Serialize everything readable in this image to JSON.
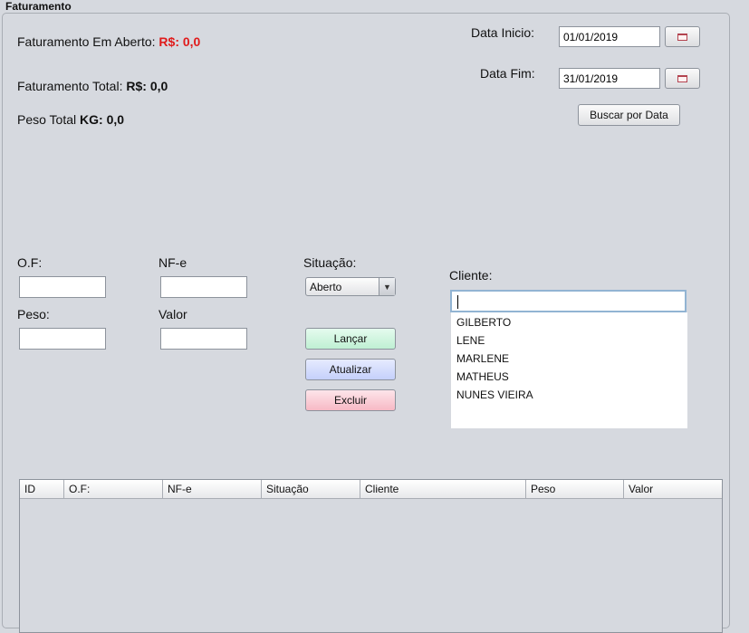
{
  "panel": {
    "title": "Faturamento"
  },
  "summary": {
    "aberto_label": "Faturamento Em Aberto:",
    "aberto_currency": "R$:",
    "aberto_value": "0,0",
    "total_label": "Faturamento Total:",
    "total_currency": "R$:",
    "total_value": "0,0",
    "peso_label": "Peso Total",
    "peso_unit": "KG:",
    "peso_value": "0,0"
  },
  "dates": {
    "inicio_label": "Data Inicio:",
    "inicio_value": "01/01/2019",
    "fim_label": "Data Fim:",
    "fim_value": "31/01/2019",
    "search_button": "Buscar por Data"
  },
  "form": {
    "of_label": "O.F:",
    "of_value": "",
    "nfe_label": "NF-e",
    "nfe_value": "",
    "peso_label": "Peso:",
    "peso_value": "",
    "valor_label": "Valor",
    "valor_value": "",
    "situacao_label": "Situação:",
    "situacao_selected": "Aberto",
    "cliente_label": "Cliente:",
    "cliente_value": ""
  },
  "actions": {
    "lancar": "Lançar",
    "atualizar": "Atualizar",
    "excluir": "Excluir"
  },
  "clientes": [
    "GILBERTO",
    "LENE",
    "MARLENE",
    "MATHEUS",
    "NUNES VIEIRA"
  ],
  "table": {
    "columns": [
      "ID",
      "O.F:",
      "NF-e",
      "Situação",
      "Cliente",
      "Peso",
      "Valor"
    ],
    "rows": []
  },
  "colors": {
    "accent_red": "#e01b1b",
    "btn_green": "#bff0d3",
    "btn_blue": "#c5d0fb",
    "btn_red": "#f7b9c5",
    "background": "#d6d9df"
  },
  "icons": {
    "calendar": "calendar-icon",
    "dropdown": "chevron-down-icon"
  }
}
